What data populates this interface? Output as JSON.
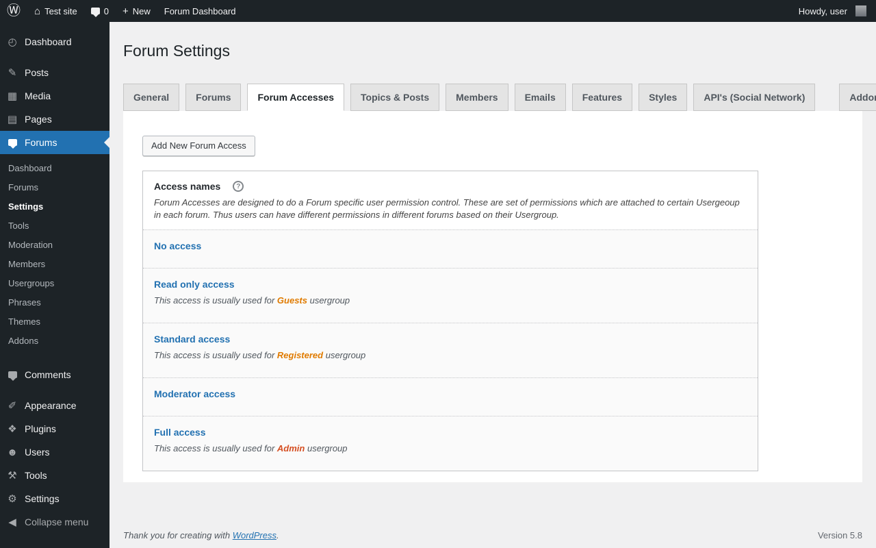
{
  "icons": {
    "wordpress_logo": "Ⓦ",
    "home": "⌂",
    "plus": "+",
    "dashboard": "◴",
    "posts": "✎",
    "media": "▦",
    "pages": "▤",
    "appearance": "✐",
    "plugins": "❖",
    "users": "☻",
    "tools": "⚒",
    "settings": "⚙",
    "collapse": "◀",
    "help": "?"
  },
  "colors": {
    "accent": "#2271b1",
    "sidebar_bg": "#1d2327",
    "page_bg": "#f0f0f1",
    "guests": "#e07b00",
    "registered": "#e07b00",
    "admin": "#d54e21"
  },
  "topbar": {
    "site_name": "Test site",
    "comments_count": "0",
    "new_label": "New",
    "forum_dashboard": "Forum Dashboard",
    "howdy": "Howdy, user"
  },
  "sidebar": {
    "items": [
      {
        "label": "Dashboard"
      },
      {
        "label": "Posts"
      },
      {
        "label": "Media"
      },
      {
        "label": "Pages"
      },
      {
        "label": "Forums"
      },
      {
        "label": "Comments"
      },
      {
        "label": "Appearance"
      },
      {
        "label": "Plugins"
      },
      {
        "label": "Users"
      },
      {
        "label": "Tools"
      },
      {
        "label": "Settings"
      },
      {
        "label": "Collapse menu"
      }
    ],
    "submenu": [
      "Dashboard",
      "Forums",
      "Settings",
      "Tools",
      "Moderation",
      "Members",
      "Usergroups",
      "Phrases",
      "Themes",
      "Addons"
    ]
  },
  "page": {
    "title": "Forum Settings",
    "tabs": [
      "General",
      "Forums",
      "Forum Accesses",
      "Topics & Posts",
      "Members",
      "Emails",
      "Features",
      "Styles",
      "API's (Social Network)",
      "Addons"
    ],
    "add_button": "Add New Forum Access"
  },
  "access_table": {
    "header": "Access names",
    "description": "Forum Accesses are designed to do a Forum specific user permission control. These are set of permissions which are attached to certain Usergeoup in each forum. Thus users can have different permissions in different forums based on their Usergroup.",
    "rows": [
      {
        "title": "No access",
        "desc_prefix": "",
        "usergroup": "",
        "desc_suffix": "",
        "usergroup_color": ""
      },
      {
        "title": "Read only access",
        "desc_prefix": "This access is usually used for ",
        "usergroup": "Guests",
        "desc_suffix": " usergroup",
        "usergroup_color": "#e07b00"
      },
      {
        "title": "Standard access",
        "desc_prefix": "This access is usually used for ",
        "usergroup": "Registered",
        "desc_suffix": " usergroup",
        "usergroup_color": "#e07b00"
      },
      {
        "title": "Moderator access",
        "desc_prefix": "",
        "usergroup": "",
        "desc_suffix": "",
        "usergroup_color": ""
      },
      {
        "title": "Full access",
        "desc_prefix": "This access is usually used for ",
        "usergroup": "Admin",
        "desc_suffix": " usergroup",
        "usergroup_color": "#d54e21"
      }
    ]
  },
  "footer": {
    "thanks_prefix": "Thank you for creating with ",
    "link": "WordPress",
    "suffix": ".",
    "version": "Version 5.8"
  }
}
